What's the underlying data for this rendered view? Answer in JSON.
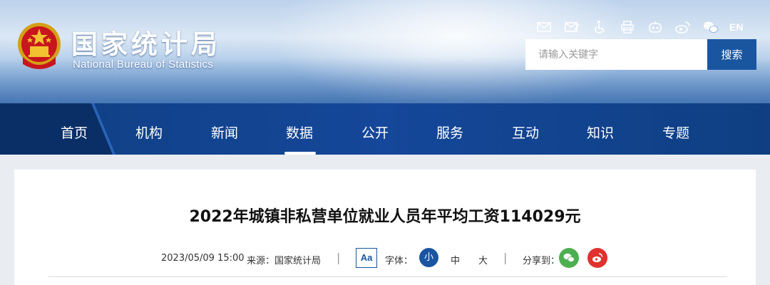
{
  "header": {
    "logo_cn": "国家统计局",
    "logo_en": "National Bureau of Statistics",
    "icons": [
      "mail-icon",
      "mail-edit-icon",
      "accessibility-icon",
      "print-icon",
      "robot-icon",
      "weibo-icon",
      "wechat-icon"
    ],
    "lang_label": "EN",
    "search": {
      "placeholder": "请输入关键字",
      "button_label": "搜索"
    }
  },
  "nav": {
    "items": [
      {
        "label": "首页"
      },
      {
        "label": "机构"
      },
      {
        "label": "新闻"
      },
      {
        "label": "数据"
      },
      {
        "label": "公开"
      },
      {
        "label": "服务"
      },
      {
        "label": "互动"
      },
      {
        "label": "知识"
      },
      {
        "label": "专题"
      }
    ],
    "active": "数据"
  },
  "article": {
    "title": "2022年城镇非私营单位就业人员年平均工资114029元",
    "date": "2023/05/09 15:00",
    "source": "来源：国家统计局",
    "sep": "|",
    "font_toggle": "Aa",
    "font_label": "字体：",
    "sizes": [
      "小",
      "中",
      "大"
    ],
    "active_size": "小",
    "share_label": "分享到：",
    "share_targets": [
      "wechat-share-icon",
      "weibo-share-icon"
    ]
  },
  "colors": {
    "primary": "#1a56a0",
    "nav_bg": "#15479a",
    "wechat": "#4caf50",
    "weibo": "#e0312e"
  }
}
